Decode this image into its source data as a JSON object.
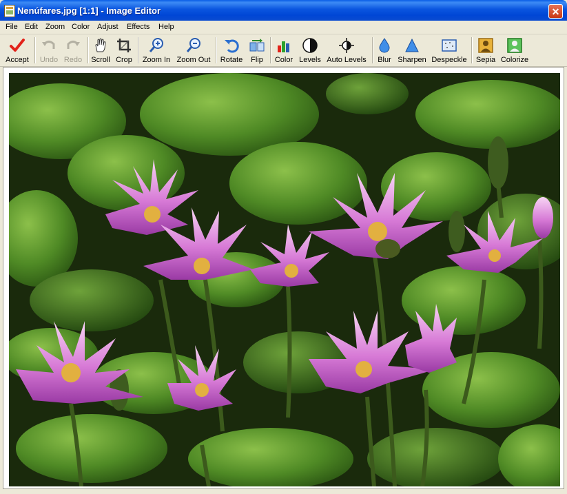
{
  "window": {
    "title": "Nenúfares.jpg [1:1] - Image Editor",
    "close_glyph": "✕"
  },
  "menu": [
    "File",
    "Edit",
    "Zoom",
    "Color",
    "Adjust",
    "Effects",
    "Help"
  ],
  "toolbar": {
    "accept": "Accept",
    "undo": "Undo",
    "redo": "Redo",
    "scroll": "Scroll",
    "crop": "Crop",
    "zoom_in": "Zoom In",
    "zoom_out": "Zoom Out",
    "rotate": "Rotate",
    "flip": "Flip",
    "color": "Color",
    "levels": "Levels",
    "auto_levels": "Auto Levels",
    "blur": "Blur",
    "sharpen": "Sharpen",
    "despeckle": "Despeckle",
    "sepia": "Sepia",
    "colorize": "Colorize"
  },
  "colors": {
    "title_blue": "#0a55df",
    "close_red": "#c93814",
    "leaf_green": "#5f9a2e",
    "petal_pink": "#c25ac7"
  }
}
